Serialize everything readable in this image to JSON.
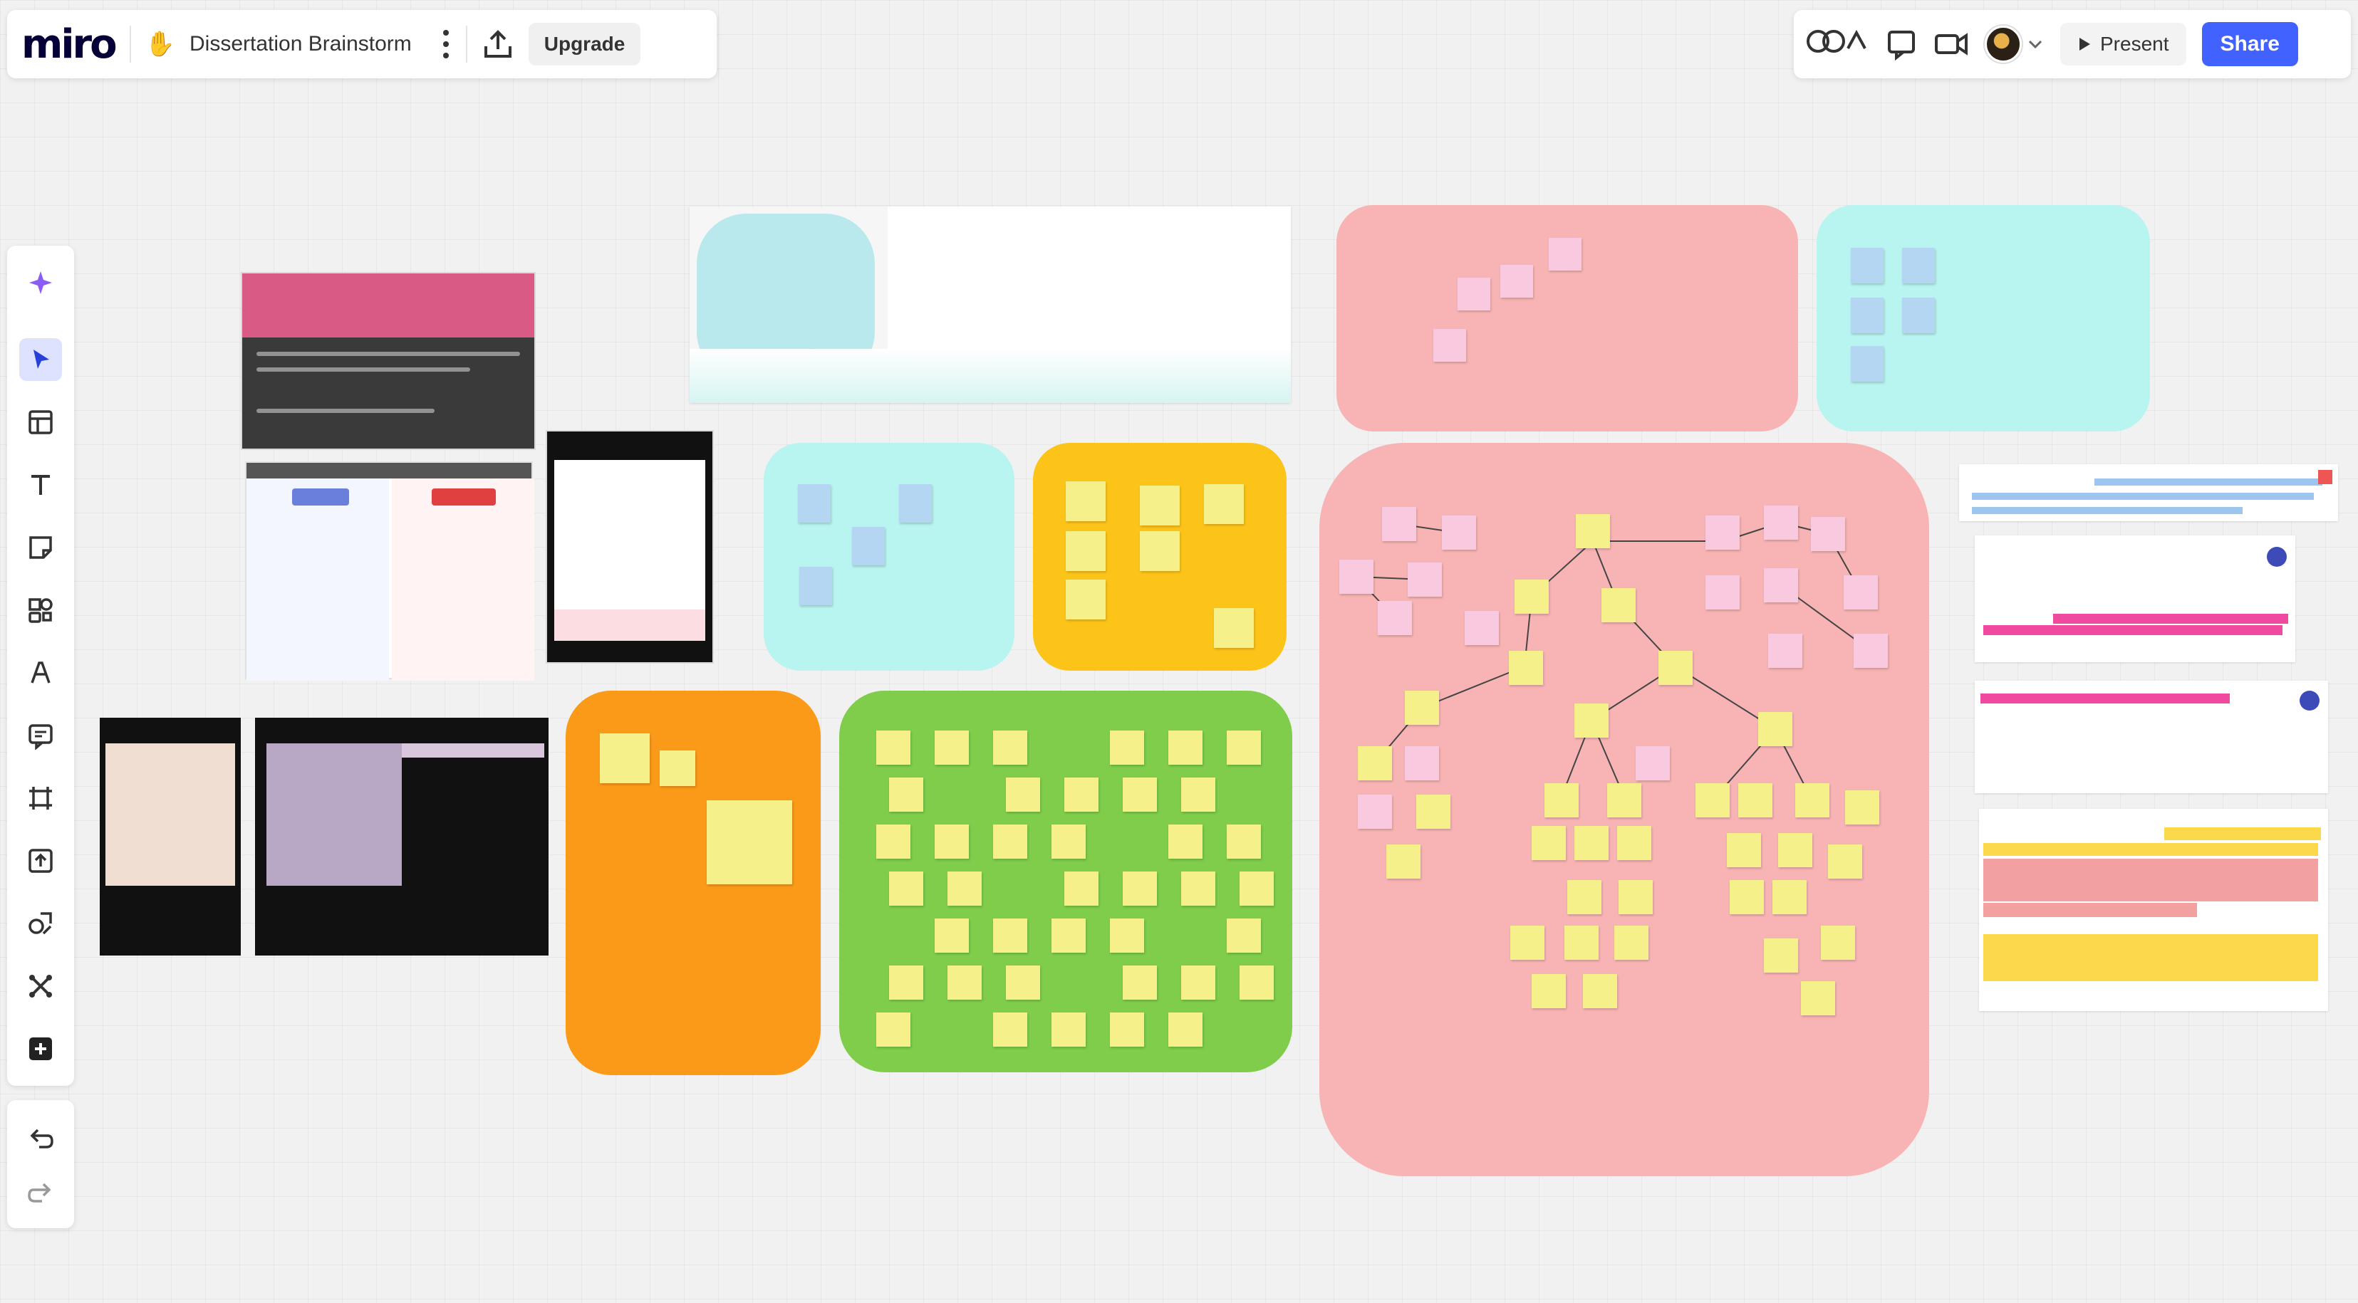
{
  "app": {
    "logo": "miro",
    "board_emoji": "✋",
    "board_title": "Dissertation Brainstorm",
    "upgrade_label": "Upgrade",
    "present_label": "Present",
    "share_label": "Share"
  },
  "toolbar": {
    "tools": [
      "ai-assist",
      "select",
      "templates",
      "text",
      "sticky-note",
      "shapes",
      "pen",
      "comment",
      "frame",
      "upload",
      "more-shapes",
      "apps",
      "add"
    ]
  },
  "colors": {
    "accent": "#4262ff",
    "pink_frame": "#f8b4b4",
    "cyan_frame": "#b8f4f0",
    "yellow_frame": "#fcc419",
    "orange_frame": "#fa9a18",
    "green_frame": "#7fcd4a",
    "sticky_yellow": "#f6f08a",
    "sticky_pink": "#f9c9e0",
    "sticky_blue": "#b4d6f2"
  }
}
